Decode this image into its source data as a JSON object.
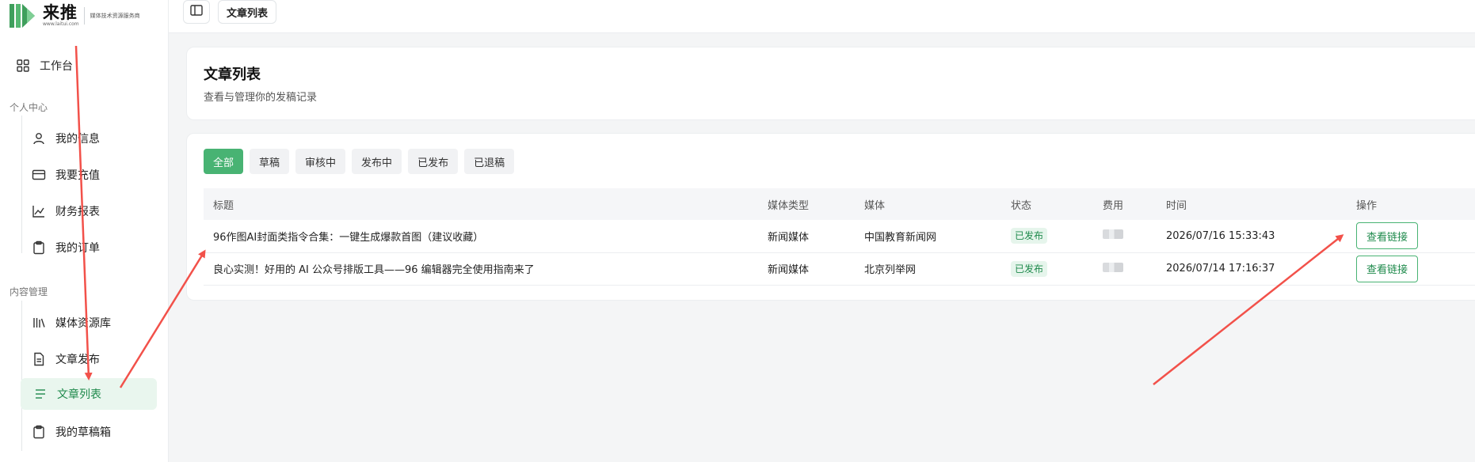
{
  "brand": {
    "name": "来推",
    "url": "www.laitui.com",
    "slogan": "媒体技术资源服务商",
    "accent_color": "#3f9f5c"
  },
  "sidebar": {
    "workbench": {
      "label": "工作台",
      "icon": "grid-icon"
    },
    "sections": [
      {
        "title": "个人中心",
        "items": [
          {
            "label": "我的信息",
            "icon": "user-icon"
          },
          {
            "label": "我要充值",
            "icon": "card-icon"
          },
          {
            "label": "财务报表",
            "icon": "chart-line-icon"
          },
          {
            "label": "我的订单",
            "icon": "clipboard-icon"
          }
        ]
      },
      {
        "title": "内容管理",
        "items": [
          {
            "label": "媒体资源库",
            "icon": "library-icon"
          },
          {
            "label": "文章发布",
            "icon": "document-icon"
          },
          {
            "label": "文章列表",
            "icon": "list-icon",
            "active": true
          },
          {
            "label": "我的草稿箱",
            "icon": "clipboard-icon"
          }
        ]
      }
    ]
  },
  "topbar": {
    "toggle_icon": "sidebar-toggle-icon",
    "active_tab": "文章列表"
  },
  "header": {
    "title": "文章列表",
    "subtitle": "查看与管理你的发稿记录"
  },
  "filters": [
    {
      "label": "全部",
      "active": true
    },
    {
      "label": "草稿"
    },
    {
      "label": "审核中"
    },
    {
      "label": "发布中"
    },
    {
      "label": "已发布"
    },
    {
      "label": "已退稿"
    }
  ],
  "table": {
    "columns": [
      "标题",
      "媒体类型",
      "媒体",
      "状态",
      "费用",
      "时间",
      "操作"
    ],
    "rows": [
      {
        "title": "96作图AI封面类指令合集：一键生成爆款首图（建议收藏）",
        "media_type": "新闻媒体",
        "media": "中国教育新闻网",
        "status": "已发布",
        "time": "2026/07/16 15:33:43",
        "action": "查看链接"
      },
      {
        "title": "良心实测！好用的 AI 公众号排版工具——96 编辑器完全使用指南来了",
        "media_type": "新闻媒体",
        "media": "北京列举网",
        "status": "已发布",
        "time": "2026/07/14 17:16:37",
        "action": "查看链接"
      }
    ]
  },
  "colors": {
    "active_green": "#48b373",
    "status_green": "#1f8a4c",
    "annotation_red": "#f2514a"
  }
}
